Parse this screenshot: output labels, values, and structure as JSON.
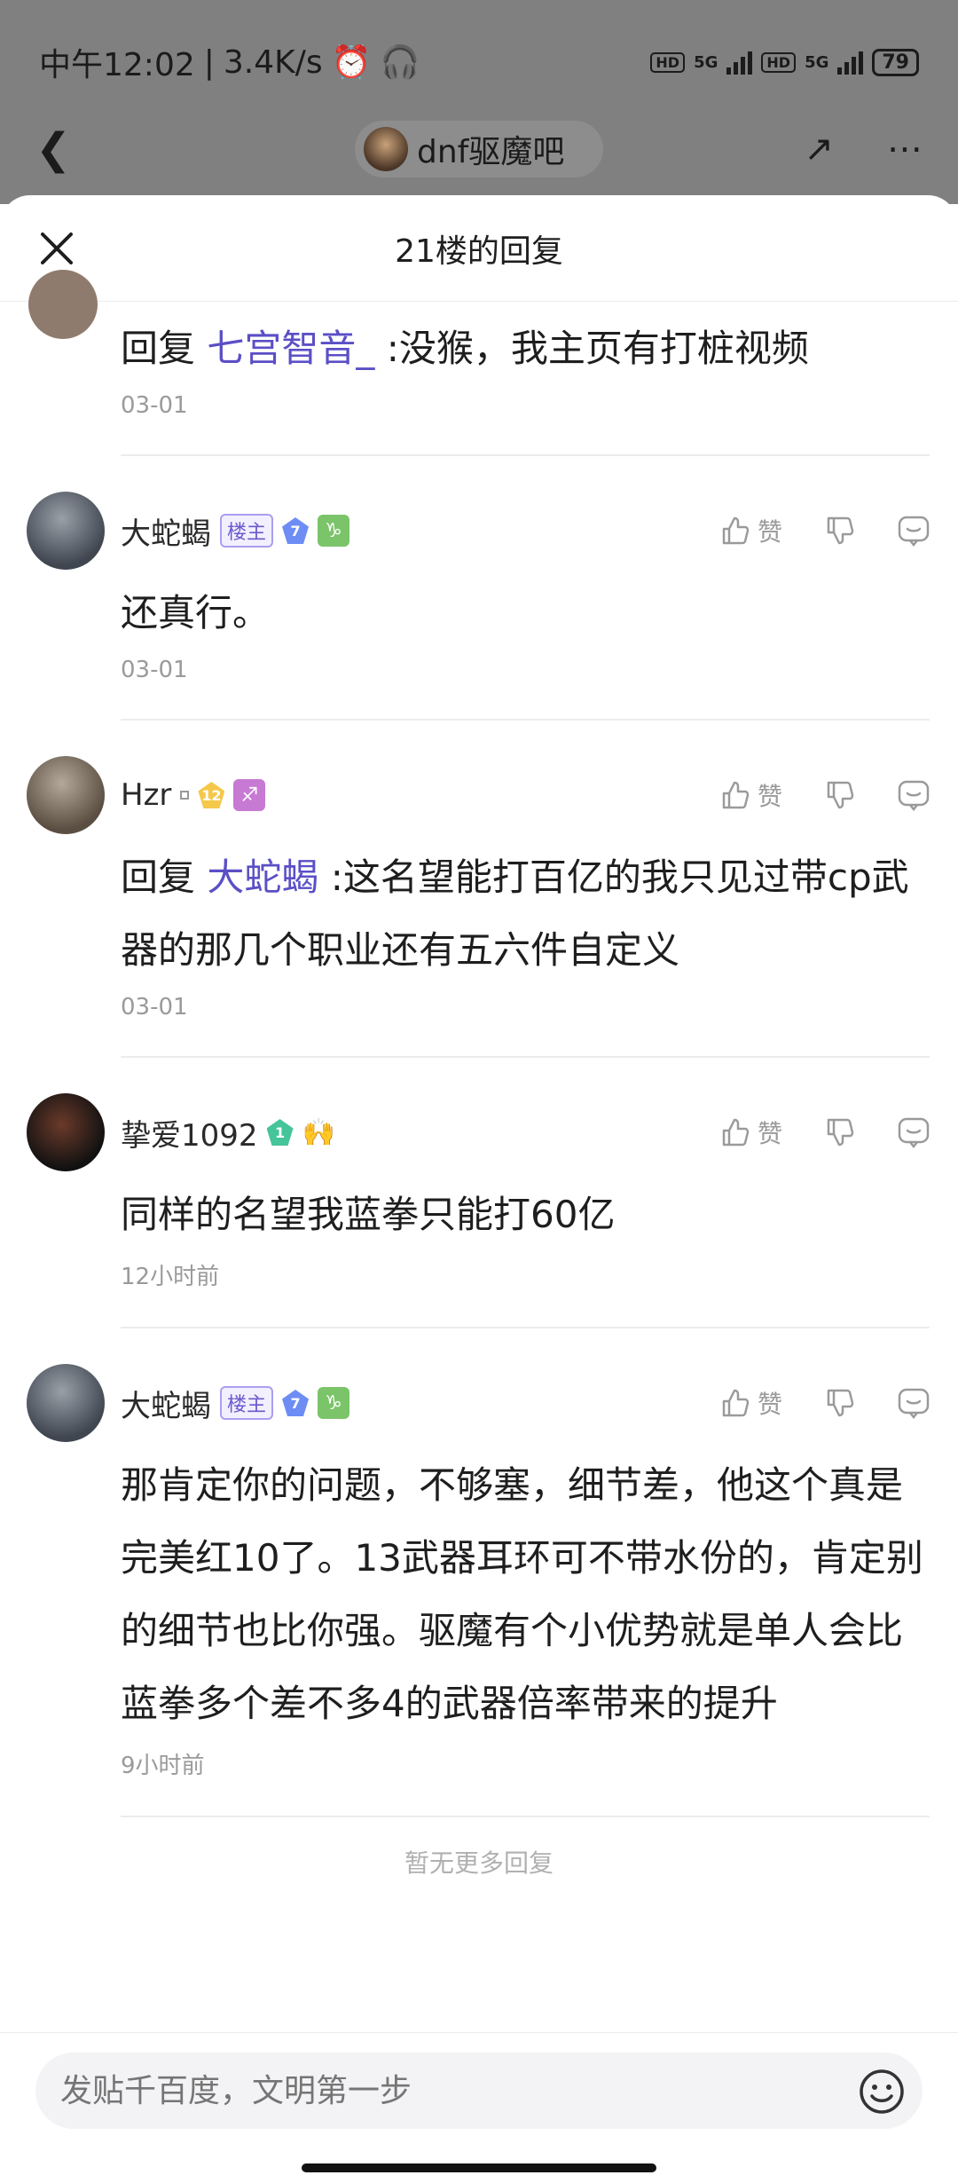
{
  "statusbar": {
    "time": "中午12:02",
    "speed": "3.4K/s",
    "hd1": "HD",
    "sig1": "5G",
    "hd2": "HD",
    "sig2": "5G",
    "battery": "79"
  },
  "topnav": {
    "forum_name": "dnf驱魔吧"
  },
  "sheet": {
    "title": "21楼的回复"
  },
  "replies": [
    {
      "prefix": "回复",
      "mention": "七宫智音_",
      "text": ":没猴，我主页有打桩视频",
      "time": "03-01"
    },
    {
      "username": "大蛇蝎",
      "owner_badge": "楼主",
      "level": "7",
      "like_label": "赞",
      "text": "还真行。",
      "time": "03-01"
    },
    {
      "username": "Hzr",
      "level": "12",
      "like_label": "赞",
      "prefix": "回复",
      "mention": "大蛇蝎",
      "text": ":这名望能打百亿的我只见过带cp武器的那几个职业还有五六件自定义",
      "time": "03-01"
    },
    {
      "username": "挚爱1092",
      "level": "1",
      "like_label": "赞",
      "text": "同样的名望我蓝拳只能打60亿",
      "time": "12小时前"
    },
    {
      "username": "大蛇蝎",
      "owner_badge": "楼主",
      "level": "7",
      "like_label": "赞",
      "text": "那肯定你的问题，不够塞，细节差，他这个真是完美红10了。13武器耳环可不带水份的，肯定别的细节也比你强。驱魔有个小优势就是单人会比蓝拳多个差不多4的武器倍率带来的提升",
      "time": "9小时前"
    }
  ],
  "footer": {
    "no_more": "暂无更多回复"
  },
  "composer": {
    "placeholder": "发贴千百度，文明第一步"
  },
  "colors": {
    "mention": "#5b4fc6",
    "owner_badge": "#6a5acd",
    "backdrop": "#808080"
  }
}
